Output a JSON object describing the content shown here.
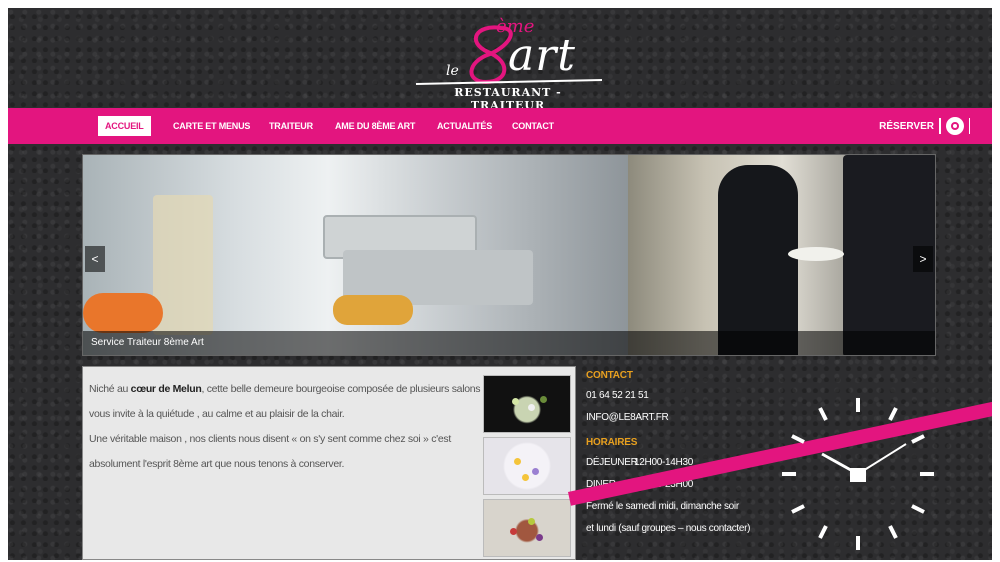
{
  "logo": {
    "le": "le",
    "eme": "ème",
    "art": "art",
    "subtitle": "RESTAURANT - TRAITEUR"
  },
  "nav": {
    "items": [
      {
        "label": "ACCUEIL",
        "active": true
      },
      {
        "label": "CARTE ET MENUS",
        "active": false
      },
      {
        "label": "TRAITEUR",
        "active": false
      },
      {
        "label": "AME DU 8ÈME ART",
        "active": false
      },
      {
        "label": "ACTUALITÉS",
        "active": false
      },
      {
        "label": "CONTACT",
        "active": false
      }
    ],
    "reserve_label": "RÉSERVER",
    "reserve_icon": "reserve-circle-icon"
  },
  "slider": {
    "caption": "Service Traiteur 8ème Art",
    "prev_label": "<",
    "next_label": ">"
  },
  "intro": {
    "lines": [
      {
        "pre": "Niché au ",
        "bold": "cœur de Melun",
        "post": ", cette belle demeure bourgeoise composée de plusieurs salons"
      },
      {
        "pre": "vous invite à la quiétude , au calme et au plaisir de la chair.",
        "bold": "",
        "post": ""
      },
      {
        "pre": "Une véritable maison , nos clients nous disent « on s'y sent comme chez soi » c'est",
        "bold": "",
        "post": ""
      },
      {
        "pre": "absolument l'esprit 8ème art que nous tenons à conserver.",
        "bold": "",
        "post": ""
      }
    ]
  },
  "contact": {
    "heading": "CONTACT",
    "phone": "01 64 52 21 51",
    "email": "INFO@LE8ART.FR"
  },
  "hours": {
    "heading": "HORAIRES",
    "rows": [
      {
        "label": "DÉJEUNER",
        "value": "12H00-14H30"
      },
      {
        "label": "DINER",
        "value": "19H00-23H00"
      }
    ],
    "note1": "Fermé le samedi midi, dimanche soir",
    "note2": "et lundi (sauf groupes – nous contacter)"
  },
  "colors": {
    "brand": "#e3157f",
    "accent": "#e8a01f",
    "background": "#2d2d2f"
  }
}
